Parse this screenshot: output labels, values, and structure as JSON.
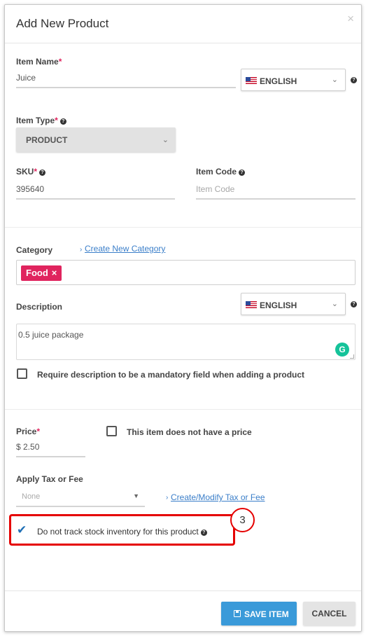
{
  "modal": {
    "title": "Add New Product",
    "close_glyph": "×"
  },
  "item_name": {
    "label": "Item Name",
    "required_mark": "*",
    "value": "Juice",
    "language": "ENGLISH"
  },
  "item_type": {
    "label": "Item Type",
    "required_mark": "*",
    "value": "PRODUCT"
  },
  "sku": {
    "label": "SKU",
    "required_mark": "*",
    "value": "395640"
  },
  "item_code": {
    "label": "Item Code",
    "placeholder": "Item Code"
  },
  "category": {
    "label": "Category",
    "link_prefix": "›",
    "create_link": "Create New Category",
    "tags": [
      "Food"
    ],
    "tag_remove_glyph": "×"
  },
  "description": {
    "label": "Description",
    "language": "ENGLISH",
    "value": "0.5 juice package",
    "mandatory_checkbox_label": "Require description to be a mandatory field when adding a product",
    "mandatory_checked": false
  },
  "price": {
    "label": "Price",
    "required_mark": "*",
    "value": "$ 2.50",
    "no_price_label": "This item does not have a price",
    "no_price_checked": false
  },
  "tax": {
    "label": "Apply Tax or Fee",
    "selected": "None",
    "link_prefix": "›",
    "modify_link": "Create/Modify Tax or Fee"
  },
  "stock": {
    "label": "Do not track stock inventory for this product",
    "checked": true
  },
  "annotation": {
    "step_number": "3"
  },
  "footer": {
    "save_label": "SAVE ITEM",
    "cancel_label": "CANCEL"
  },
  "icons": {
    "help": "question-circle-icon",
    "save": "floppy-disk-icon",
    "grammarly": "grammarly-icon",
    "flag": "us-flag-icon"
  },
  "colors": {
    "accent_blue": "#3a9ad9",
    "tag_red": "#e0245e",
    "highlight_red": "#e50000",
    "link_blue": "#3a7ec9"
  }
}
